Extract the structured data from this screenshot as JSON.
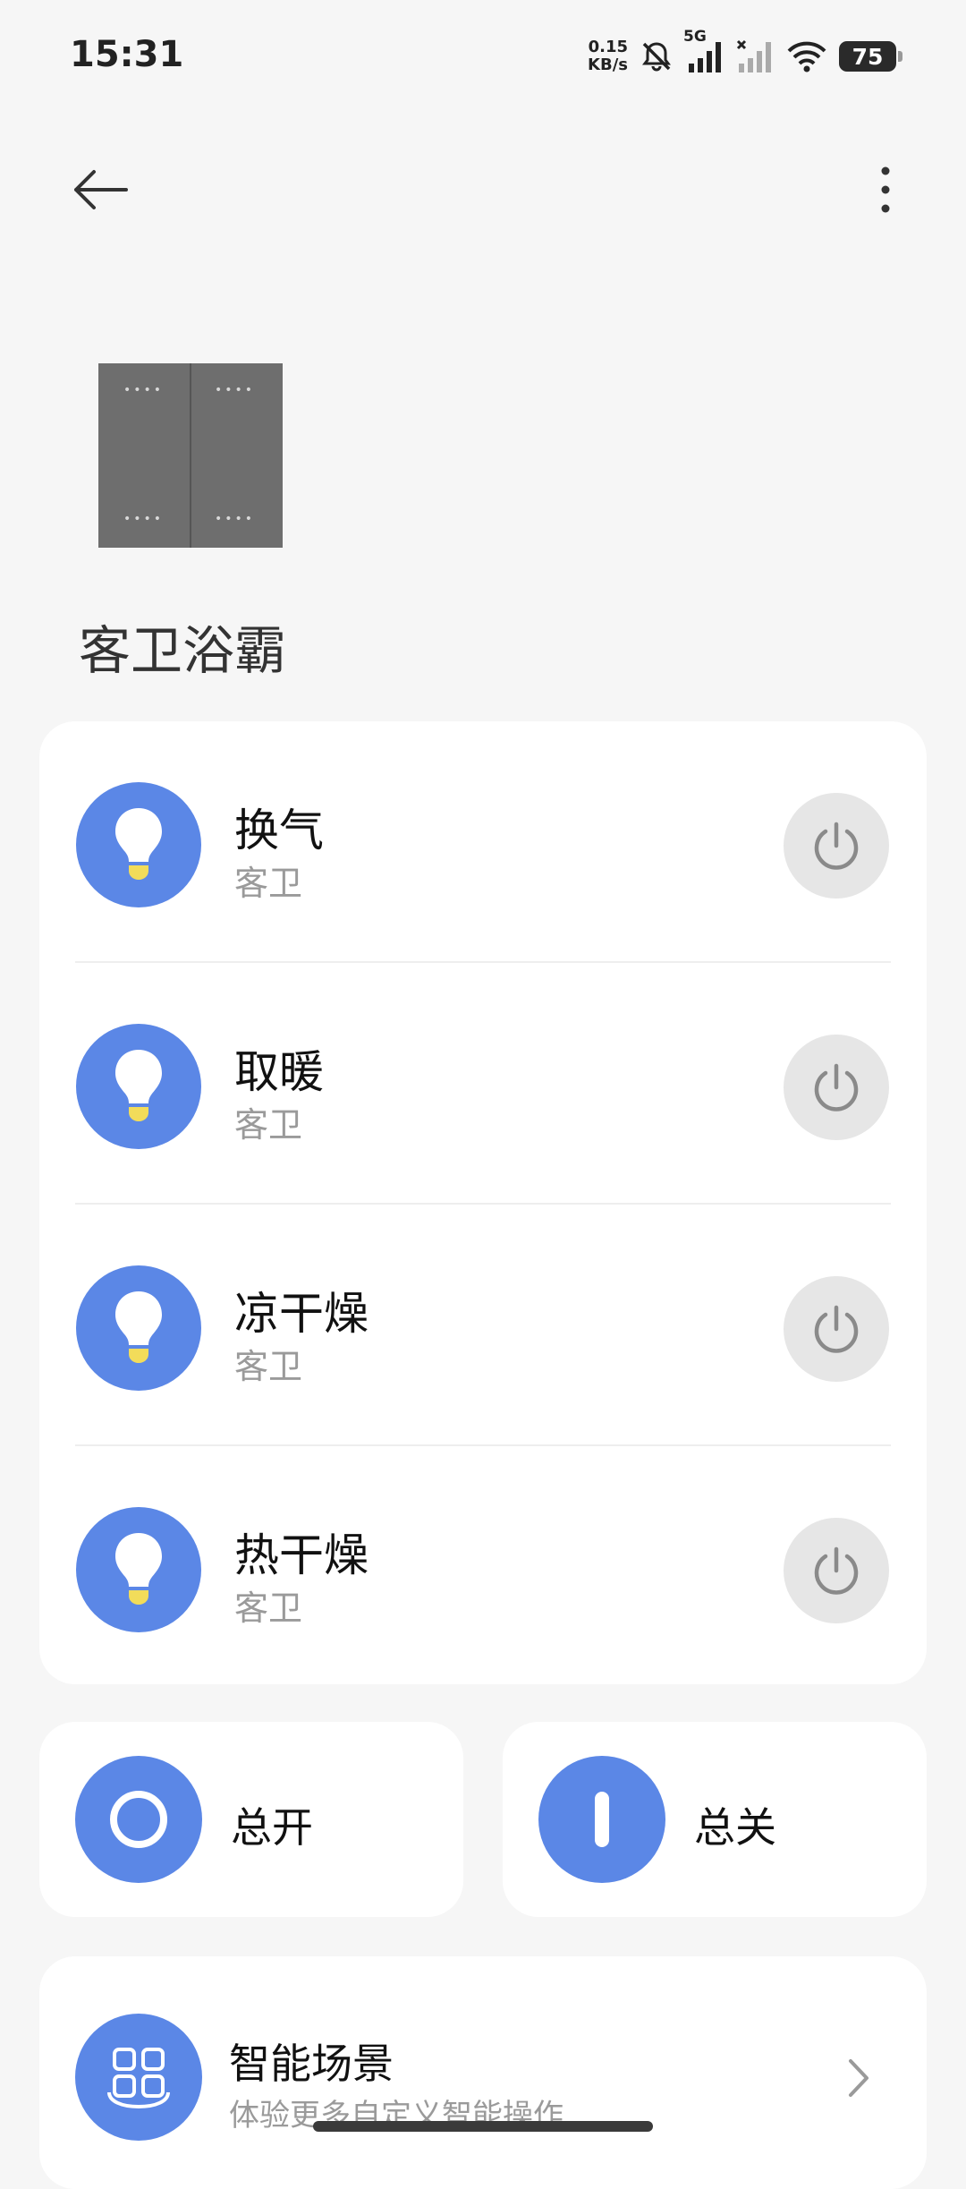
{
  "status_bar": {
    "time": "15:31",
    "net_speed_value": "0.15",
    "net_speed_unit": "KB/s",
    "network_type": "5G",
    "battery": "75",
    "icons": [
      "mute-bell-icon",
      "signal-5g-icon",
      "signal-off-icon",
      "wifi-icon",
      "battery-icon"
    ]
  },
  "top_bar": {
    "back_icon": "back-arrow-icon",
    "more_icon": "more-vertical-icon"
  },
  "device": {
    "title": "客卫浴霸"
  },
  "switches": [
    {
      "name": "换气",
      "room": "客卫",
      "icon": "bulb-icon",
      "power_icon": "power-icon"
    },
    {
      "name": "取暖",
      "room": "客卫",
      "icon": "bulb-icon",
      "power_icon": "power-icon"
    },
    {
      "name": "凉干燥",
      "room": "客卫",
      "icon": "bulb-icon",
      "power_icon": "power-icon"
    },
    {
      "name": "热干燥",
      "room": "客卫",
      "icon": "bulb-icon",
      "power_icon": "power-icon"
    }
  ],
  "master": {
    "all_on_label": "总开",
    "all_off_label": "总关"
  },
  "scene": {
    "title": "智能场景",
    "subtitle": "体验更多自定义智能操作"
  },
  "colors": {
    "accent": "#5b87e6",
    "bulb_base": "#f2dc5a",
    "background": "#f6f6f6",
    "card": "#ffffff"
  }
}
